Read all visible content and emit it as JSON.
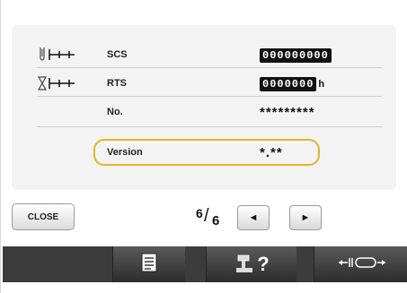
{
  "rows": [
    {
      "name": "scs",
      "label": "SCS",
      "value": "000000000",
      "unit": "",
      "boxed": true
    },
    {
      "name": "rts",
      "label": "RTS",
      "value": "0000000",
      "unit": "h",
      "boxed": true
    },
    {
      "name": "no",
      "label": "No.",
      "value": "*********",
      "unit": "",
      "boxed": false
    },
    {
      "name": "version",
      "label": "Version",
      "value": "*.**",
      "unit": "",
      "boxed": false
    }
  ],
  "close_label": "CLOSE",
  "page": {
    "current": "6",
    "total": "6"
  },
  "nav": {
    "prev": "◄",
    "next": "►"
  },
  "toolbar": {
    "doc_icon": "document-list-icon",
    "machine_help_icon": "machine-help-icon",
    "frame_move_icon": "frame-move-icon",
    "help_mark": "?"
  },
  "colors": {
    "highlight": "#e4b52a",
    "toolbar": "#3c3c3c"
  }
}
